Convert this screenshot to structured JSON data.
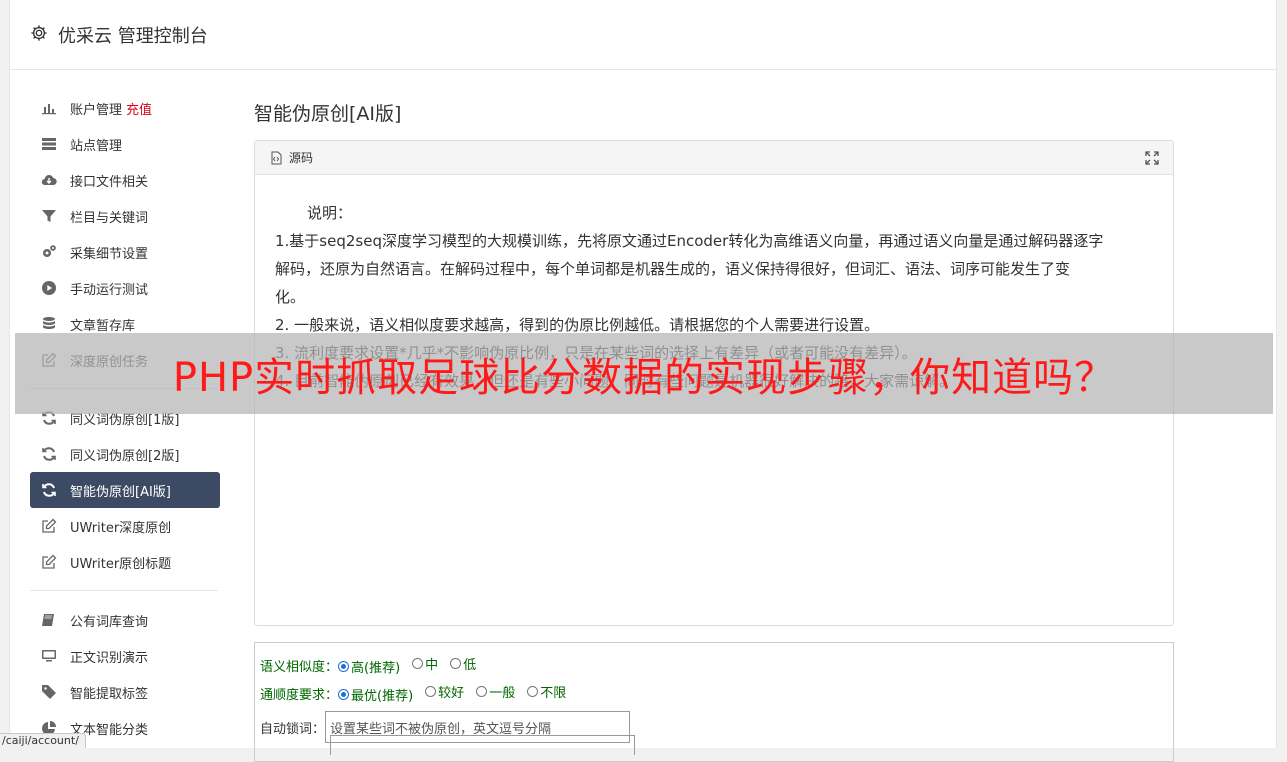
{
  "app": {
    "title": "优采云 管理控制台",
    "icon": "gear-icon"
  },
  "sidebar": {
    "group1": [
      {
        "label": "账户管理",
        "badge": "充值",
        "icon": "bar-chart-icon",
        "active": false
      },
      {
        "label": "站点管理",
        "icon": "server-icon",
        "active": false
      },
      {
        "label": "接口文件相关",
        "icon": "cloud-download-icon",
        "active": false
      },
      {
        "label": "栏目与关键词",
        "icon": "filter-icon",
        "active": false
      },
      {
        "label": "采集细节设置",
        "icon": "gears-icon",
        "active": false
      },
      {
        "label": "手动运行测试",
        "icon": "play-circle-icon",
        "active": false
      },
      {
        "label": "文章暂存库",
        "icon": "database-icon",
        "active": false
      },
      {
        "label": "深度原创任务",
        "icon": "edit-icon",
        "active": false
      }
    ],
    "group2": [
      {
        "label": "同义词伪原创[1版]",
        "icon": "refresh-icon",
        "active": false
      },
      {
        "label": "同义词伪原创[2版]",
        "icon": "refresh-icon",
        "active": false
      },
      {
        "label": "智能伪原创[AI版]",
        "icon": "refresh-icon",
        "active": true
      },
      {
        "label": "UWriter深度原创",
        "icon": "edit-icon",
        "active": false
      },
      {
        "label": "UWriter原创标题",
        "icon": "edit-icon",
        "active": false
      }
    ],
    "group3": [
      {
        "label": "公有词库查询",
        "icon": "book-icon",
        "active": false
      },
      {
        "label": "正文识别演示",
        "icon": "monitor-icon",
        "active": false
      },
      {
        "label": "智能提取标签",
        "icon": "tag-icon",
        "active": false
      },
      {
        "label": "文本智能分类",
        "icon": "pie-chart-icon",
        "active": false
      }
    ]
  },
  "main": {
    "title": "智能伪原创[AI版]",
    "panel": {
      "tab_label": "源码",
      "lines": [
        "说明：",
        "1.基于seq2seq深度学习模型的大规模训练，先将原文通过Encoder转化为高维语义向量，再通过语义向量是通过解码器逐字",
        "解码，还原为自然语言。在解码过程中，每个单词都是机器生成的，语义保持得很好，但词汇、语法、词序可能发生了变",
        "化。",
        "2. 一般来说，语义相似度要求越高，得到的伪原比例越低。请根据您的个人需要进行设置。",
        "3. 流利度要求设置*几乎*不影响伪原比例，只是在某些词的选择上有差异（或者可能没有差异）。",
        "4. 目前智能伪原创已经有效果，但还是有些小问题，同时有些问题是机器很好解决的路，大家需谅解。"
      ]
    },
    "options": {
      "similarity": {
        "label": "语义相似度：",
        "choices": [
          "高(推荐)",
          "中",
          "低"
        ],
        "selected": "高(推荐)"
      },
      "fluency": {
        "label": "通顺度要求：",
        "choices": [
          "最优(推荐)",
          "较好",
          "一般",
          "不限"
        ],
        "selected": "最优(推荐)"
      },
      "lock": {
        "label": "自动锁词：",
        "placeholder": "设置某些词不被伪原创，英文逗号分隔"
      }
    }
  },
  "overlay": {
    "text": "PHP实时抓取足球比分数据的实现步骤，你知道吗？",
    "color": "#ff1a1a"
  },
  "status_url": "/caiji/account/",
  "colors": {
    "active_bg": "#3c4a63",
    "badge": "#d9001b",
    "option_text": "#006600"
  }
}
